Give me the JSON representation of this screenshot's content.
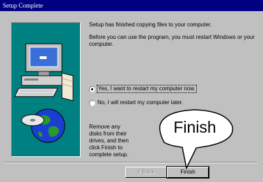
{
  "window": {
    "title": "Setup Complete"
  },
  "message": {
    "line1": "Setup has finished copying files to your computer.",
    "line2": "Before you can use the program, you must restart Windows or your computer.",
    "line3": "Remove any disks from their drives, and then click Finish to complete setup."
  },
  "options": [
    {
      "label": "Yes, I want to restart my computer now.",
      "checked": true
    },
    {
      "label": "No, I will restart my computer later.",
      "checked": false
    }
  ],
  "buttons": {
    "back": "< Back",
    "finish": "Finish"
  },
  "callout": {
    "text": "Finish"
  },
  "icons": {
    "computer": "computer-icon",
    "globe": "globe-icon"
  },
  "colors": {
    "titlebar": "#000080",
    "panel": "#008080",
    "background": "#c0c0c0"
  }
}
